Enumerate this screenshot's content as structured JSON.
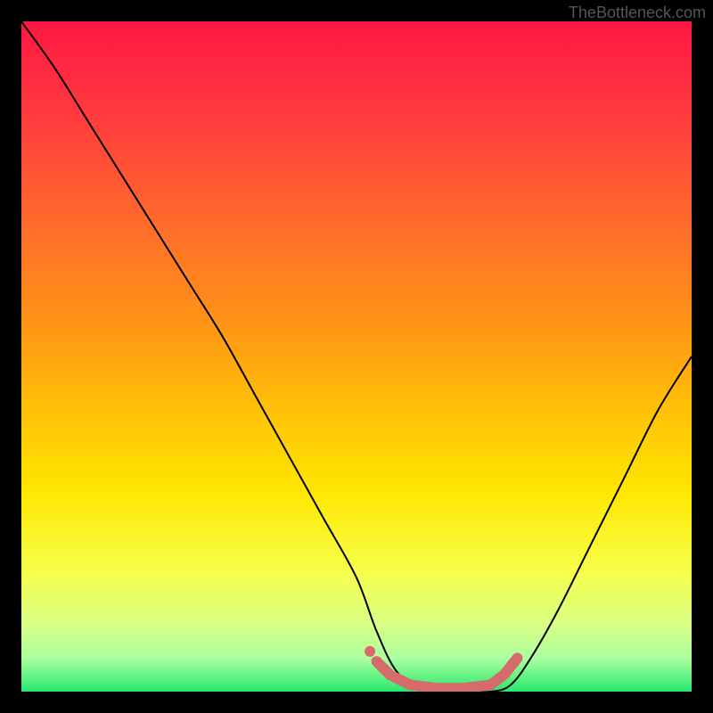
{
  "watermark": "TheBottleneck.com",
  "chart_data": {
    "type": "line",
    "title": "",
    "xlabel": "",
    "ylabel": "",
    "xlim": [
      0,
      100
    ],
    "ylim": [
      0,
      100
    ],
    "series": [
      {
        "name": "bottleneck-curve",
        "x": [
          0,
          5,
          10,
          15,
          20,
          25,
          30,
          35,
          40,
          45,
          50,
          53,
          56,
          60,
          65,
          70,
          73,
          76,
          80,
          85,
          90,
          95,
          100
        ],
        "y": [
          100,
          93,
          85,
          77,
          69,
          61,
          53,
          44,
          35,
          26,
          17,
          9,
          3,
          0,
          0,
          0,
          1,
          5,
          12,
          22,
          32,
          42,
          50
        ]
      }
    ],
    "highlight": {
      "name": "optimal-range",
      "x": [
        53,
        55,
        58,
        62,
        66,
        70,
        72,
        74
      ],
      "y": [
        4.5,
        2.5,
        1,
        0.5,
        0.5,
        1,
        2.5,
        5
      ]
    },
    "gradient_stops": [
      {
        "offset": 0,
        "color": "#ff1744"
      },
      {
        "offset": 15,
        "color": "#ff3d3d"
      },
      {
        "offset": 30,
        "color": "#ff6b2b"
      },
      {
        "offset": 45,
        "color": "#ff9416"
      },
      {
        "offset": 58,
        "color": "#ffc107"
      },
      {
        "offset": 70,
        "color": "#ffe600"
      },
      {
        "offset": 82,
        "color": "#f6ff4a"
      },
      {
        "offset": 90,
        "color": "#d9ff85"
      },
      {
        "offset": 95,
        "color": "#adffa0"
      },
      {
        "offset": 100,
        "color": "#27e86f"
      }
    ]
  }
}
